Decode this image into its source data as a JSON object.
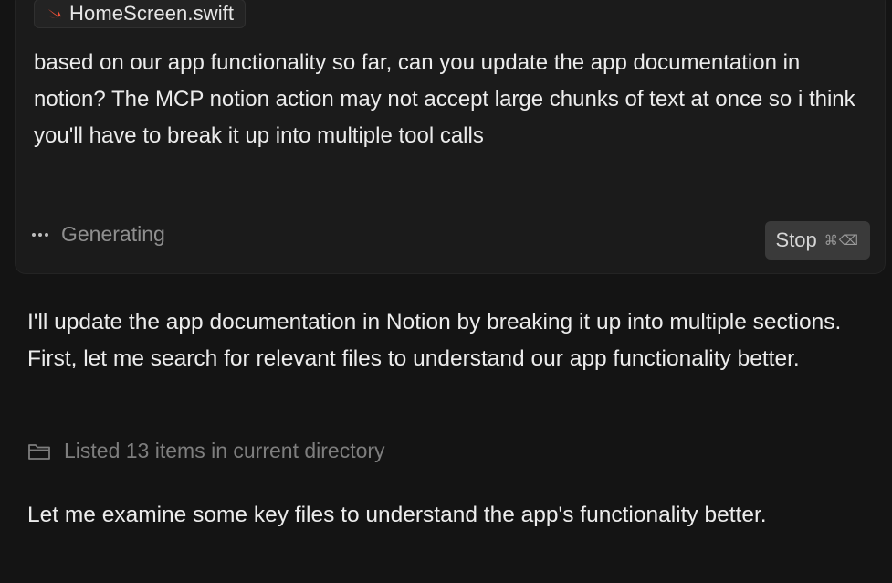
{
  "prompt": {
    "file_chip": {
      "icon": "swift-icon",
      "label": "HomeScreen.swift"
    },
    "text": "based on our app functionality so far, can you update the app documentation in notion? The MCP notion action may not accept large chunks of text at once so i think you'll have to break it up into multiple tool calls",
    "status": {
      "icon": "ellipsis-icon",
      "label": "Generating"
    },
    "stop_button": {
      "label": "Stop",
      "shortcut": "⌘⌫"
    }
  },
  "response": {
    "intro": "I'll update the app documentation in Notion by breaking it up into multiple sections. First, let me search for relevant files to understand our app functionality better.",
    "tool_call": {
      "icon": "folder-icon",
      "label": "Listed 13 items in current directory"
    },
    "followup": "Let me examine some key files to understand the app's functionality better."
  },
  "colors": {
    "background": "#141414",
    "card": "#1b1b1b",
    "swift_orange": "#f05138",
    "muted_text": "#8f8f8f",
    "stop_button_bg": "#3a3a3a"
  }
}
